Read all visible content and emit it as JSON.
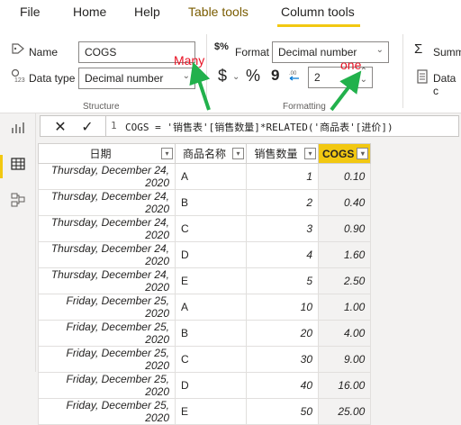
{
  "menubar": {
    "items": [
      {
        "label": "File"
      },
      {
        "label": "Home"
      },
      {
        "label": "Help"
      },
      {
        "label": "Table tools"
      },
      {
        "label": "Column tools"
      }
    ]
  },
  "ribbon": {
    "name_label": "Name",
    "name_value": "COGS",
    "datatype_label": "Data type",
    "datatype_value": "Decimal number",
    "structure_label": "Structure",
    "format_label": "Format",
    "format_value": "Decimal number",
    "decimals_value": "2",
    "formatting_label": "Formatting",
    "summarization_label": "Summ",
    "datacategory_label": "Data c",
    "currency_symbol": "$",
    "percent_symbol": "%",
    "comma_symbol": "9"
  },
  "annotations": {
    "many": "Many",
    "one": "one"
  },
  "formula_bar": {
    "line_number": "1",
    "formula": "COGS = '销售表'[销售数量]*RELATED('商品表'[进价])"
  },
  "table": {
    "columns": [
      "日期",
      "商品名称",
      "销售数量",
      "COGS"
    ],
    "rows": [
      [
        "Thursday, December 24, 2020",
        "A",
        "1",
        "0.10"
      ],
      [
        "Thursday, December 24, 2020",
        "B",
        "2",
        "0.40"
      ],
      [
        "Thursday, December 24, 2020",
        "C",
        "3",
        "0.90"
      ],
      [
        "Thursday, December 24, 2020",
        "D",
        "4",
        "1.60"
      ],
      [
        "Thursday, December 24, 2020",
        "E",
        "5",
        "2.50"
      ],
      [
        "Friday, December 25, 2020",
        "A",
        "10",
        "1.00"
      ],
      [
        "Friday, December 25, 2020",
        "B",
        "20",
        "4.00"
      ],
      [
        "Friday, December 25, 2020",
        "C",
        "30",
        "9.00"
      ],
      [
        "Friday, December 25, 2020",
        "D",
        "40",
        "16.00"
      ],
      [
        "Friday, December 25, 2020",
        "E",
        "50",
        "25.00"
      ]
    ]
  },
  "colors": {
    "accent": "#f2c811",
    "annotation_red": "#e81123",
    "arrow_green": "#22b14c"
  }
}
